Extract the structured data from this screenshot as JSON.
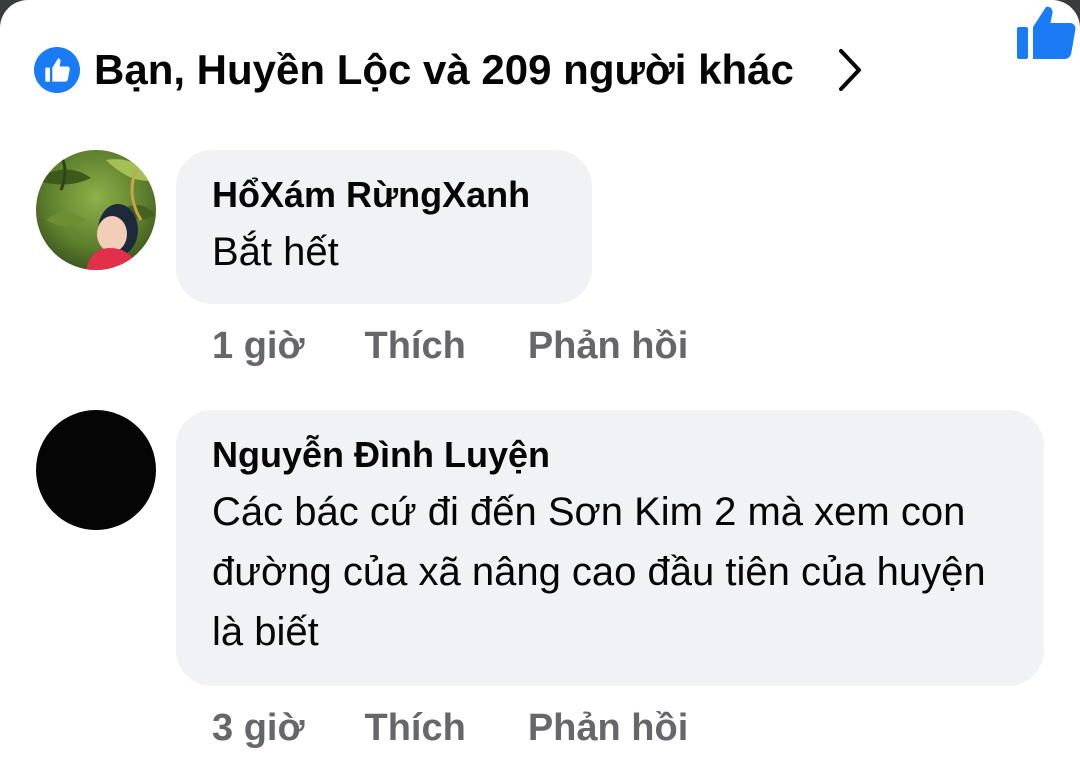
{
  "reactions": {
    "summary": "Bạn, Huyền Lộc và 209 người khác",
    "icon": "like-icon",
    "chevron_icon": "chevron-right-icon",
    "like_button_icon": "thumbs-up-icon",
    "accent": "#1a7cf5"
  },
  "comments": [
    {
      "author": "HổXám RừngXanh",
      "text": "Bắt hết",
      "time": "1 giờ",
      "like_label": "Thích",
      "reply_label": "Phản hồi"
    },
    {
      "author": "Nguyễn Đình Luyện",
      "text": "Các bác cứ đi đến Sơn Kim 2 mà xem con đường của xã nâng cao đầu tiên của huyện là biết",
      "time": "3 giờ",
      "like_label": "Thích",
      "reply_label": "Phản hồi"
    }
  ]
}
